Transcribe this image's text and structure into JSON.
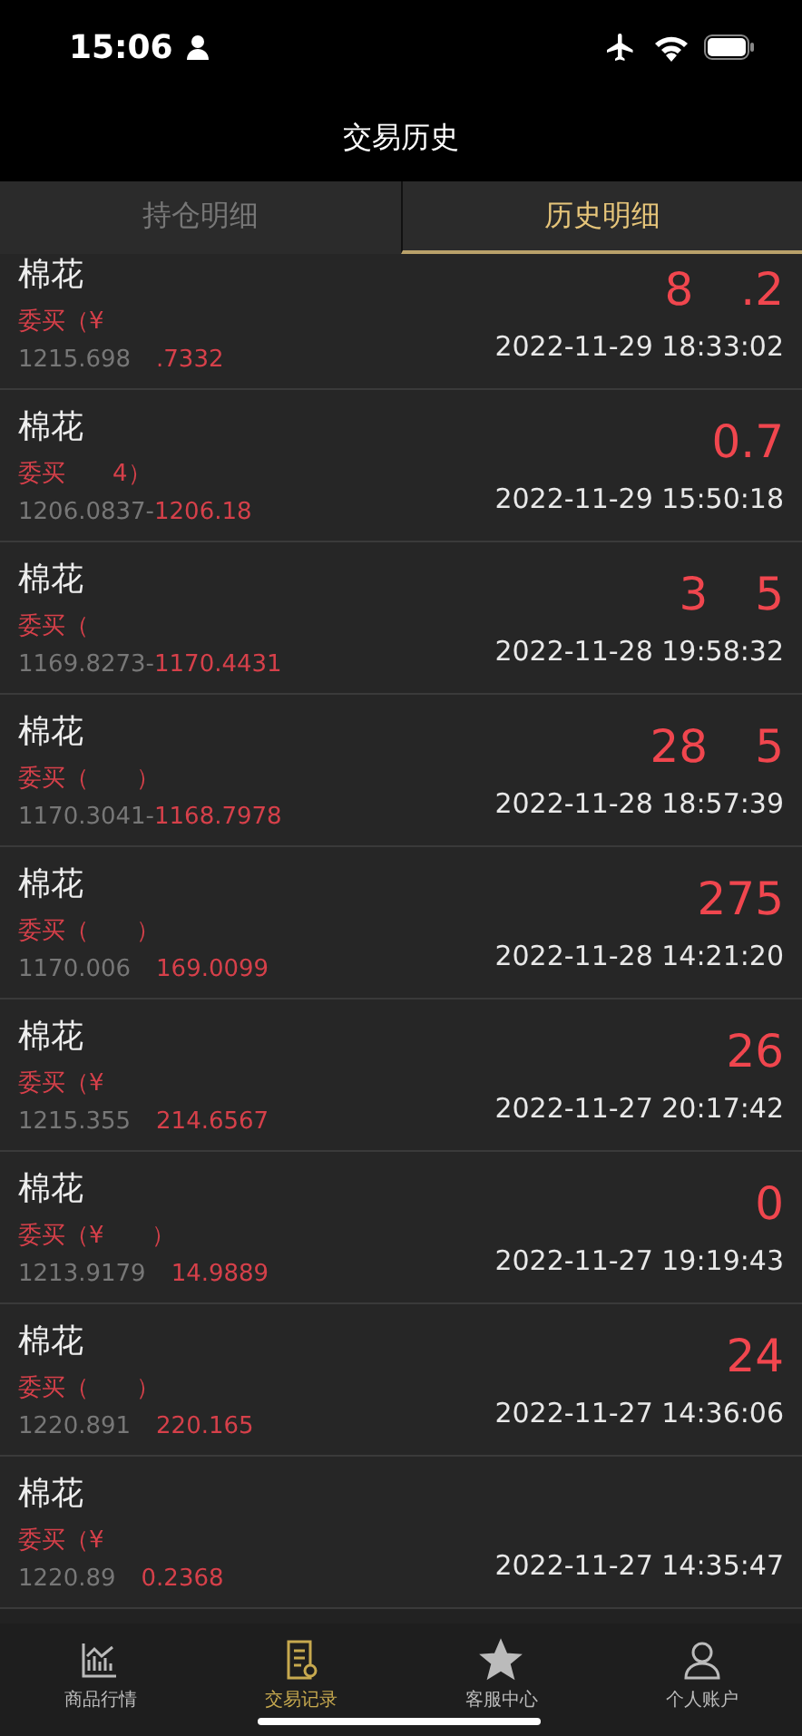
{
  "status_bar": {
    "time": "15:06"
  },
  "title": "交易历史",
  "tabs": [
    {
      "label": "持仓明细",
      "selected": false
    },
    {
      "label": "历史明细",
      "selected": true
    }
  ],
  "records": [
    {
      "name": "棉花",
      "order_parts": [
        "委买（¥"
      ],
      "price_from": "1215.698",
      "price_to": ".7332",
      "amount_parts": [
        "8",
        ".2"
      ],
      "time": "2022-11-29 18:33:02"
    },
    {
      "name": "棉花",
      "order_parts": [
        "委买",
        "4）"
      ],
      "price_from": "1206.0837-",
      "price_to": "1206.18",
      "amount_parts": [
        "0.7"
      ],
      "time": "2022-11-29 15:50:18"
    },
    {
      "name": "棉花",
      "order_parts": [
        "委买（"
      ],
      "price_from": "1169.8273-",
      "price_to": "1170.4431",
      "amount_parts": [
        "3",
        "5"
      ],
      "time": "2022-11-28 19:58:32"
    },
    {
      "name": "棉花",
      "order_parts": [
        "委买（",
        "）"
      ],
      "price_from": "1170.3041-",
      "price_to": "1168.7978",
      "amount_parts": [
        "28",
        "5"
      ],
      "time": "2022-11-28 18:57:39"
    },
    {
      "name": "棉花",
      "order_parts": [
        "委买（",
        "）"
      ],
      "price_from": "1170.006",
      "price_to": "169.0099",
      "amount_parts": [
        "275"
      ],
      "time": "2022-11-28 14:21:20"
    },
    {
      "name": "棉花",
      "order_parts": [
        "委买（¥"
      ],
      "price_from": "1215.355",
      "price_to": "214.6567",
      "amount_parts": [
        "26"
      ],
      "time": "2022-11-27 20:17:42"
    },
    {
      "name": "棉花",
      "order_parts": [
        "委买（¥",
        "）"
      ],
      "price_from": "1213.9179",
      "price_to": "14.9889",
      "amount_parts": [
        "0"
      ],
      "time": "2022-11-27 19:19:43"
    },
    {
      "name": "棉花",
      "order_parts": [
        "委买（",
        "）"
      ],
      "price_from": "1220.891",
      "price_to": "220.165",
      "amount_parts": [
        "24"
      ],
      "time": "2022-11-27 14:36:06"
    },
    {
      "name": "棉花",
      "order_parts": [
        "委买（¥"
      ],
      "price_from": "1220.89",
      "price_to": "0.2368",
      "time": "2022-11-27 14:35:47"
    }
  ],
  "tab_bar": [
    {
      "label": "商品行情",
      "kind": "chart",
      "selected": false
    },
    {
      "label": "交易记录",
      "kind": "record",
      "selected": true
    },
    {
      "label": "客服中心",
      "kind": "star",
      "selected": false
    },
    {
      "label": "个人账户",
      "kind": "person",
      "selected": false
    }
  ]
}
